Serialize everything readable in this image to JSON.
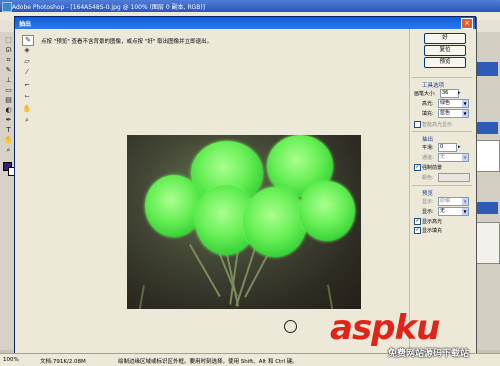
{
  "app": {
    "title": "Adobe Photoshop - [164A548S-0.jpg @ 100% (图层 0 副本, RGB)]"
  },
  "dialog": {
    "title": "抽出",
    "close_icon": "close-icon",
    "hint": "点按 \"预览\" 查看不含背景的图像，或点按 \"好\" 取出图像并立即退出。",
    "tools": [
      "edge-highlighter-icon",
      "fill-icon",
      "eraser-icon",
      "eyedropper-icon",
      "cleanup-icon",
      "edge-touchup-icon",
      "hand-icon",
      "zoom-icon"
    ],
    "buttons": {
      "ok": "好",
      "reset": "复位",
      "preview": "预览"
    },
    "tool_options": {
      "section": "工具选项",
      "brush_size_label": "画笔大小:",
      "brush_size_value": "36",
      "highlight_label": "高光:",
      "highlight_value": "绿色",
      "fill_label": "填充:",
      "fill_value": "蓝色",
      "smart_highlight_label": "智能高光显示"
    },
    "extraction": {
      "section": "抽出",
      "smooth_label": "平滑:",
      "smooth_value": "0",
      "channel_label": "通道:",
      "channel_value": "无",
      "force_fg_label": "强制前景",
      "color_label": "颜色:"
    },
    "preview": {
      "section": "预览",
      "view_label": "显示:",
      "view_value": "原稿",
      "show_label": "显示:",
      "show_value": "无",
      "show_highlight_label": "显示高光",
      "show_fill_label": "显示填充"
    }
  },
  "status": {
    "zoom": "100%",
    "doc": "文档:791K/2.08M",
    "hint": "绘制边缘区域或标识区外框。要用时刻选择，使用 Shift、Alt 和 Ctrl 键。"
  },
  "watermark": {
    "logo": "aspku",
    "sub": "免费网站源码下载站"
  },
  "colors": {
    "highlight": "#3ad338",
    "titlebar": "#0a5ede",
    "watermark": "#e2231a"
  }
}
